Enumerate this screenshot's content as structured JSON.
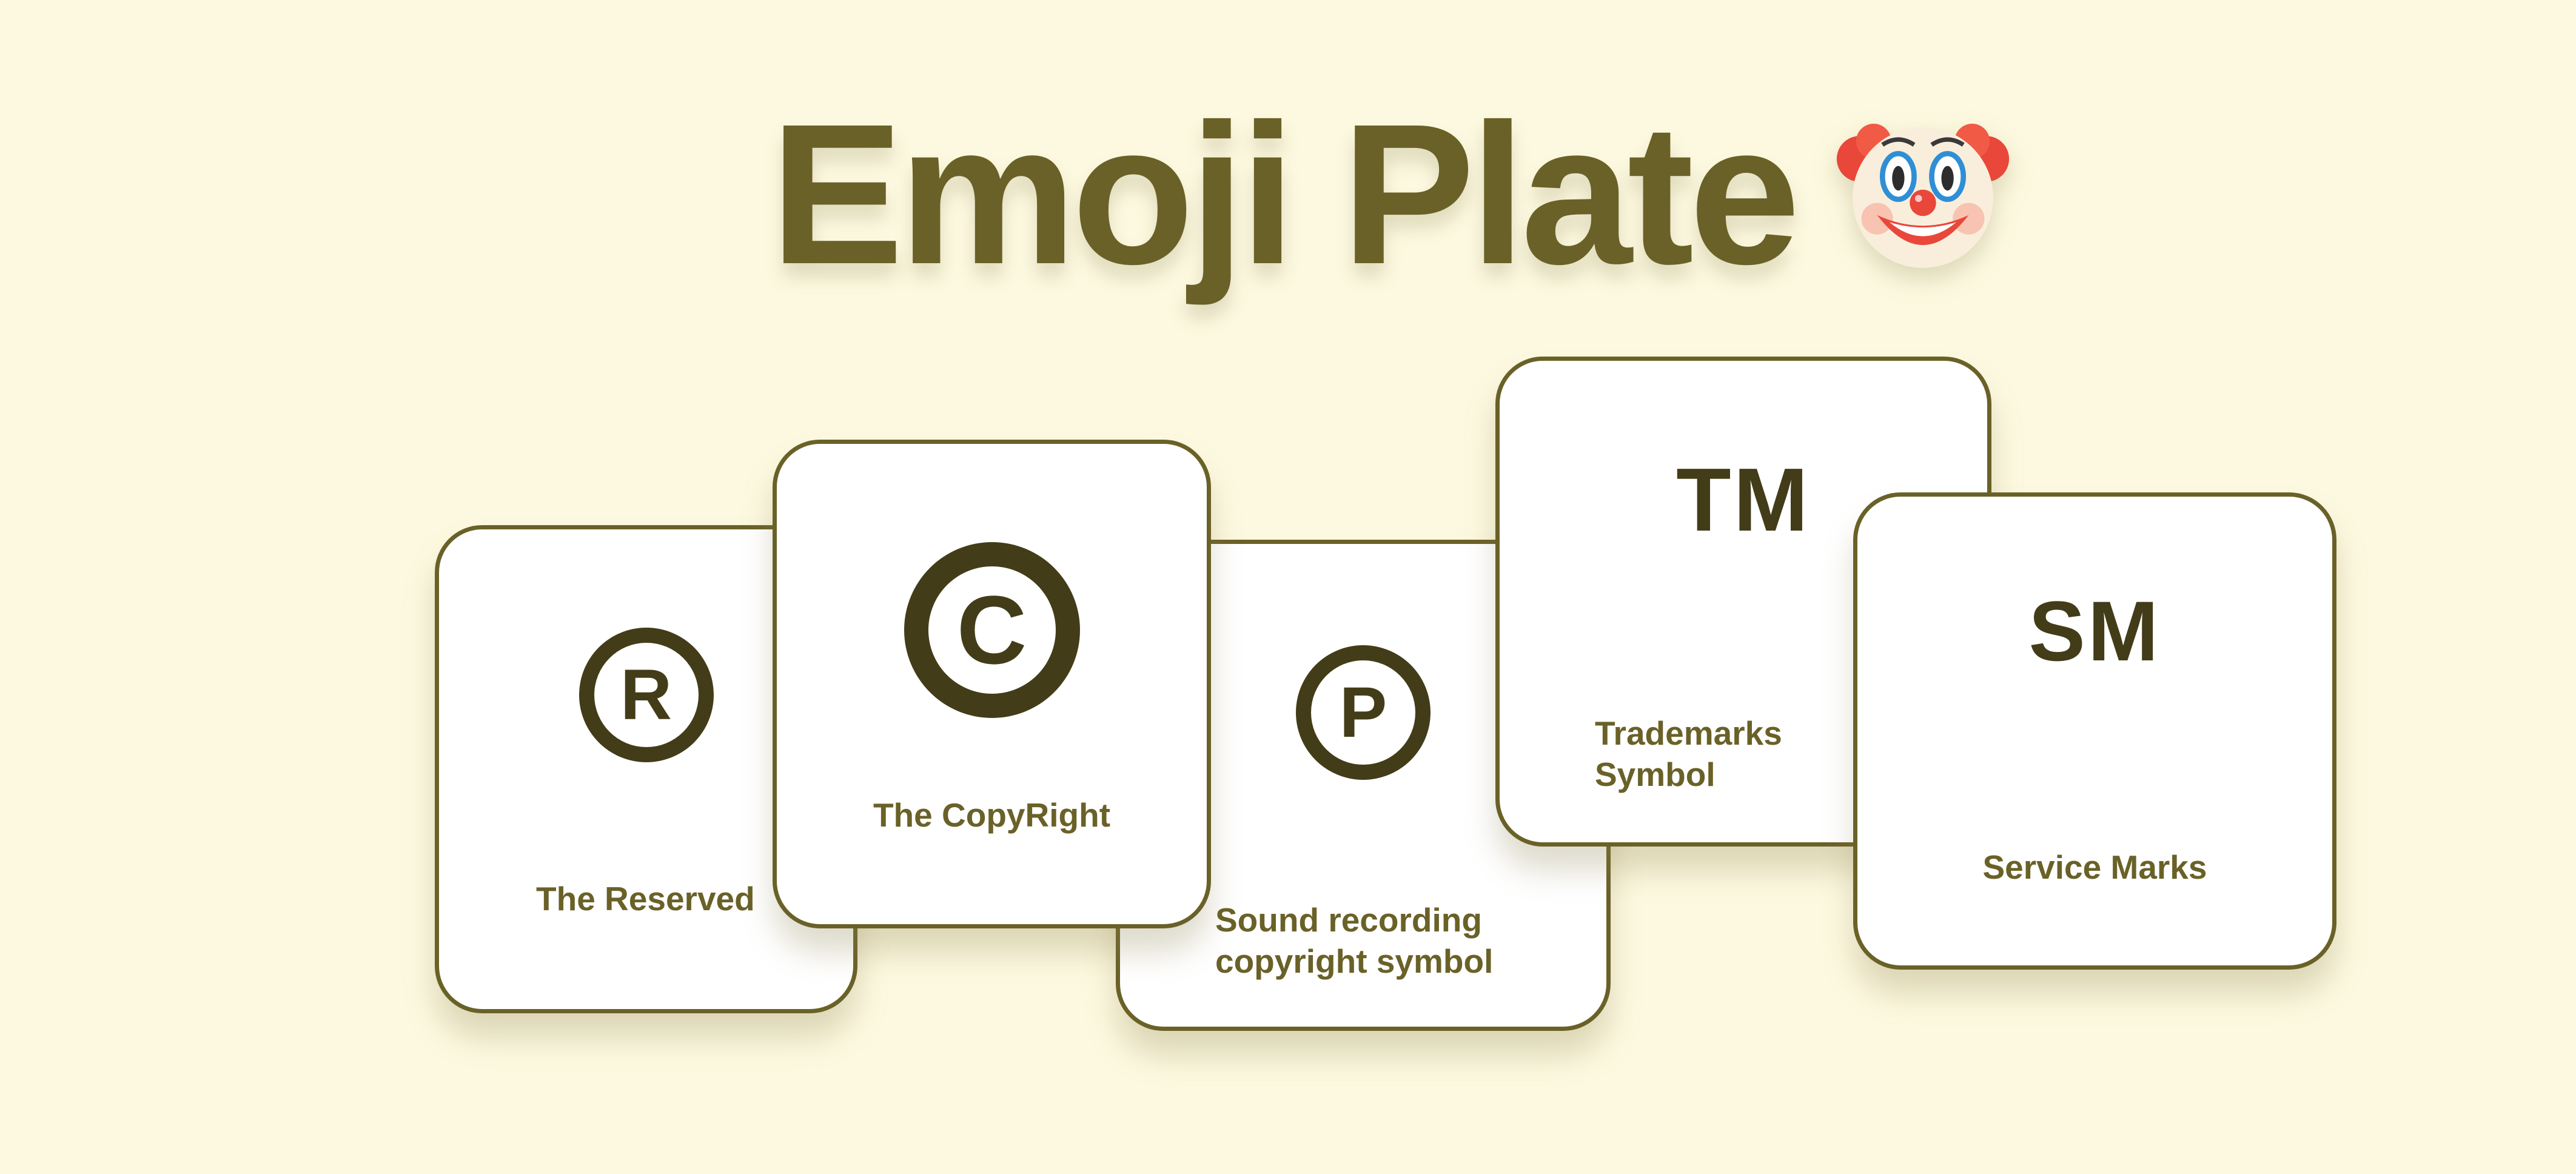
{
  "title": {
    "text": "Emoji Plate",
    "emoji_icon": "clown-face-icon"
  },
  "colors": {
    "background": "#fdf9e0",
    "accent": "#6a6128",
    "symbol": "#433c18",
    "card": "#ffffff"
  },
  "cards": {
    "reserved": {
      "symbol": "R",
      "label": "The Reserved"
    },
    "copyright": {
      "symbol": "C",
      "label": "The CopyRight"
    },
    "sound": {
      "symbol": "P",
      "label_line1": "Sound recording",
      "label_line2": "copyright symbol"
    },
    "trademark": {
      "symbol": "TM",
      "label_line1": "Trademarks",
      "label_line2": "Symbol"
    },
    "service": {
      "symbol": "SM",
      "label": "Service Marks"
    }
  }
}
